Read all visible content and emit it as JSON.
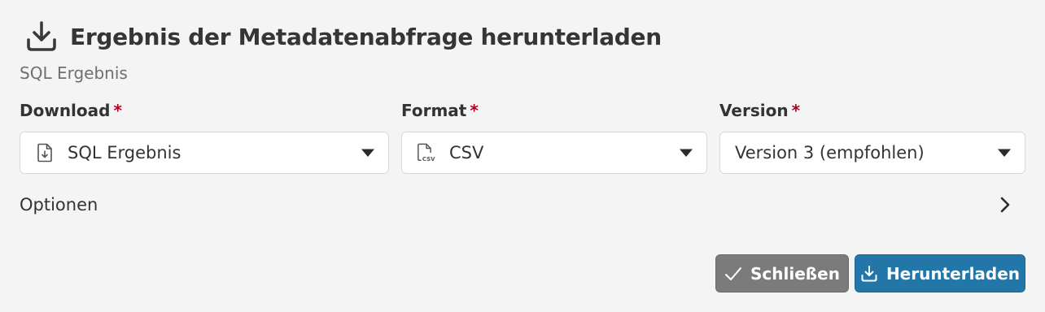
{
  "dialog": {
    "title": "Ergebnis der Metadatenabfrage herunterladen",
    "title_icon": "download-icon",
    "subtitle": "SQL Ergebnis"
  },
  "fields": {
    "download": {
      "label": "Download",
      "required_marker": "*",
      "value": "SQL Ergebnis",
      "icon": "file-download-icon"
    },
    "format": {
      "label": "Format",
      "required_marker": "*",
      "value": "CSV",
      "icon": "csv-file-icon"
    },
    "version": {
      "label": "Version",
      "required_marker": "*",
      "value": "Version 3 (empfohlen)"
    }
  },
  "options": {
    "label": "Optionen",
    "icon": "chevron-right-icon"
  },
  "buttons": {
    "close": {
      "label": "Schließen",
      "icon": "checkmark-icon"
    },
    "download": {
      "label": "Herunterladen",
      "icon": "download-icon"
    }
  },
  "colors": {
    "background": "#f4f4f4",
    "required": "#b00020",
    "primary": "#2277a8",
    "secondary": "#7b7b7b"
  }
}
